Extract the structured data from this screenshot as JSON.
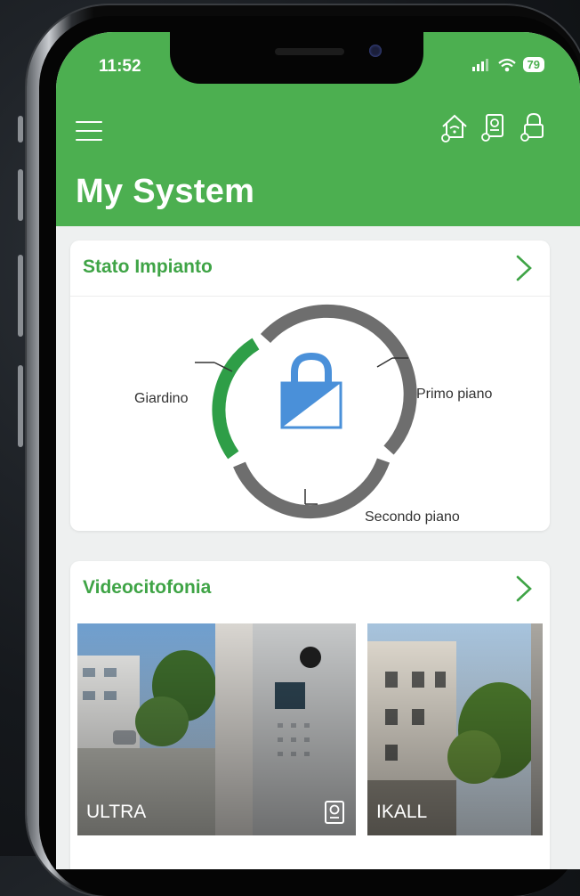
{
  "status_bar": {
    "time": "11:52",
    "battery": "79"
  },
  "header": {
    "title": "My System",
    "icons": [
      "menu-icon",
      "home-wifi-icon",
      "intercom-icon",
      "lock-icon"
    ]
  },
  "system_status": {
    "title": "Stato Impianto",
    "zones": [
      {
        "label": "Giardino",
        "state": "armed",
        "color": "#2e9e47"
      },
      {
        "label": "Primo piano",
        "state": "disarmed",
        "color": "#6e6e6e"
      },
      {
        "label": "Secondo piano",
        "state": "disarmed",
        "color": "#6e6e6e"
      }
    ],
    "lock_color": "#4a90d9"
  },
  "video_intercom": {
    "title": "Videocitofonia",
    "devices": [
      {
        "label": "ULTRA"
      },
      {
        "label": "IKALL"
      }
    ]
  },
  "colors": {
    "accent": "#4caf50",
    "title_green": "#3fa446"
  }
}
